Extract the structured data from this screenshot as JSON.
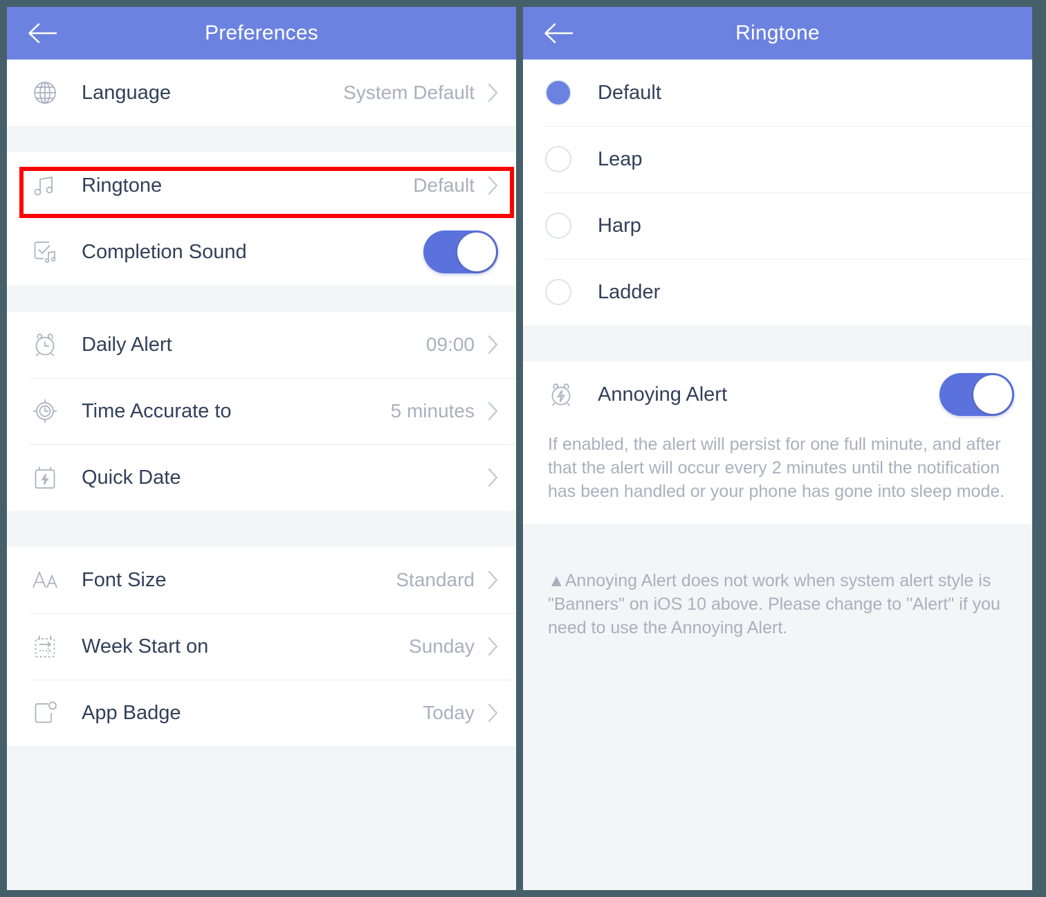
{
  "theme": {
    "accent": "#6b82e0",
    "toggle_on": "#5b72dc",
    "label_color": "#31405a",
    "value_color": "#a9b0bd",
    "page_bg": "#f3f5f7",
    "highlight_color": "#ff0000",
    "frame_color": "#46606b"
  },
  "left_screen": {
    "nav": {
      "title": "Preferences",
      "back_icon": "back-arrow-icon"
    },
    "sections": [
      {
        "rows": [
          {
            "icon": "globe-icon",
            "label": "Language",
            "value": "System Default",
            "type": "disclosure"
          }
        ]
      },
      {
        "rows": [
          {
            "icon": "music-note-icon",
            "label": "Ringtone",
            "value": "Default",
            "type": "disclosure",
            "highlighted": true
          },
          {
            "icon": "checkbox-music-icon",
            "label": "Completion Sound",
            "value": "",
            "type": "toggle",
            "toggle_on": true
          }
        ]
      },
      {
        "rows": [
          {
            "icon": "alarm-clock-icon",
            "label": "Daily Alert",
            "value": "09:00",
            "type": "disclosure"
          },
          {
            "icon": "target-clock-icon",
            "label": "Time Accurate to",
            "value": "5 minutes",
            "type": "disclosure"
          },
          {
            "icon": "calendar-bolt-icon",
            "label": "Quick Date",
            "value": "",
            "type": "disclosure"
          }
        ]
      },
      {
        "rows": [
          {
            "icon": "font-size-icon",
            "label": "Font Size",
            "value": "Standard",
            "type": "disclosure"
          },
          {
            "icon": "calendar-week-icon",
            "label": "Week Start on",
            "value": "Sunday",
            "type": "disclosure"
          },
          {
            "icon": "app-badge-icon",
            "label": "App Badge",
            "value": "Today",
            "type": "disclosure"
          }
        ]
      }
    ]
  },
  "right_screen": {
    "nav": {
      "title": "Ringtone",
      "back_icon": "back-arrow-icon"
    },
    "ringtones": [
      {
        "label": "Default",
        "selected": true
      },
      {
        "label": "Leap",
        "selected": false
      },
      {
        "label": "Harp",
        "selected": false
      },
      {
        "label": "Ladder",
        "selected": false
      }
    ],
    "annoying_alert": {
      "icon": "alarm-bolt-icon",
      "label": "Annoying Alert",
      "toggle_on": true,
      "description": "If enabled, the alert will persist for one full minute, and after that the alert will occur every 2 minutes until the notification has been handled or your phone has gone into sleep mode."
    },
    "warning": {
      "icon": "warning-triangle-icon",
      "glyph": "▲",
      "text": "Annoying Alert does not work when system alert style is \"Banners\" on iOS 10 above. Please change to \"Alert\" if you need to use the Annoying Alert."
    }
  }
}
